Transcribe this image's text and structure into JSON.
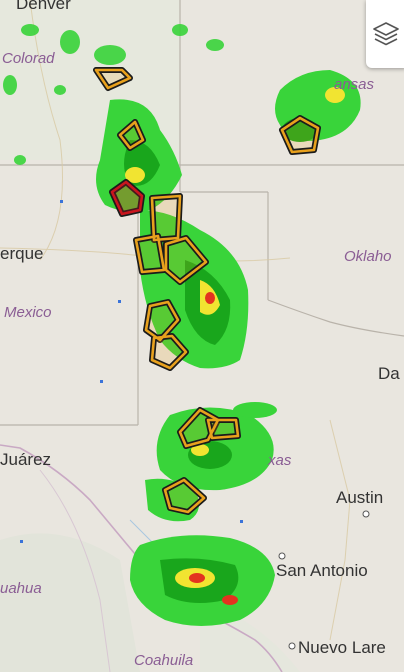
{
  "map": {
    "city_labels": {
      "denver": "Denver",
      "albuquerque": "erque",
      "juarez": "Juárez",
      "austin": "Austin",
      "san_antonio": "San Antonio",
      "nuevo_laredo": "Nuevo Lare",
      "dallas": "Da"
    },
    "region_labels": {
      "colorado": "Colorad",
      "kansas": "ansas",
      "oklahoma": "Oklaho",
      "new_mexico": "Mexico",
      "texas": "xas",
      "chihuahua": "uahua",
      "coahuila": "Coahuila"
    },
    "colors": {
      "land": "#e9e6df",
      "radar_light": "#39d43a",
      "radar_dark": "#19a61c",
      "radar_yellow": "#f1e431",
      "radar_red": "#e3331f",
      "warning_outline": "#e8a11d",
      "tornado_warning": "#c9151e"
    },
    "icons": {
      "layers": "layers-icon"
    },
    "warnings": [
      {
        "type": "severe-thunderstorm-warning"
      },
      {
        "type": "severe-thunderstorm-warning"
      },
      {
        "type": "severe-thunderstorm-warning"
      },
      {
        "type": "tornado-warning"
      },
      {
        "type": "severe-thunderstorm-warning"
      },
      {
        "type": "severe-thunderstorm-warning"
      },
      {
        "type": "severe-thunderstorm-warning"
      },
      {
        "type": "severe-thunderstorm-warning"
      },
      {
        "type": "severe-thunderstorm-warning"
      },
      {
        "type": "severe-thunderstorm-warning"
      },
      {
        "type": "severe-thunderstorm-warning"
      },
      {
        "type": "severe-thunderstorm-warning"
      }
    ]
  }
}
